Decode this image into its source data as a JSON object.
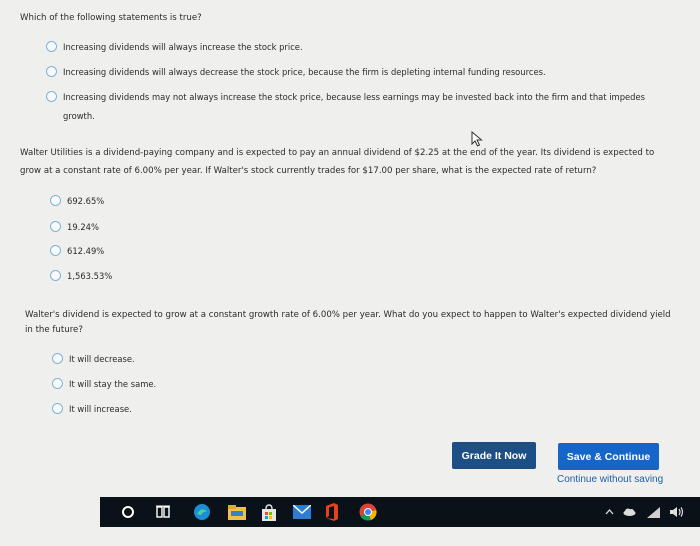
{
  "q1": {
    "prompt": "Which of the following statements is true?",
    "options": [
      "Increasing dividends will always increase the stock price.",
      "Increasing dividends will always decrease the stock price, because the firm is depleting internal funding resources.",
      "Increasing dividends may not always increase the stock price, because less earnings may be invested back into the firm and that impedes",
      "growth."
    ]
  },
  "q2": {
    "line1": "Walter Utilities is a dividend-paying company and is expected to pay an annual dividend of $2.25 at the end of the year. Its dividend is expected to",
    "line2": "grow at a constant rate of 6.00% per year. If Walter's stock currently trades for $17.00 per share, what is the expected rate of return?",
    "options": [
      "692.65%",
      "19.24%",
      "612.49%",
      "1,563.53%"
    ]
  },
  "q3": {
    "line1": "Walter's dividend is expected to grow at a constant growth rate of 6.00% per year. What do you expect to happen to Walter's expected dividend yield",
    "line2": "in the future?",
    "options": [
      "It will decrease.",
      "It will stay the same.",
      "It will increase."
    ]
  },
  "actions": {
    "grade": "Grade It Now",
    "save": "Save & Continue",
    "continue": "Continue without saving"
  },
  "colors": {
    "grade_bg": "#1d4f85",
    "save_bg": "#1666c9",
    "link": "#1e5fa8",
    "page_bg": "#efefed",
    "taskbar_bg": "#0b1118"
  },
  "taskbar": {
    "icons": [
      "cortana-icon",
      "task-view-icon",
      "edge-icon",
      "file-explorer-icon",
      "store-icon",
      "mail-icon",
      "office-icon",
      "chrome-icon"
    ],
    "tray_icons": [
      "chevron-up-icon",
      "cloud-icon",
      "wifi-icon",
      "volume-icon"
    ]
  }
}
